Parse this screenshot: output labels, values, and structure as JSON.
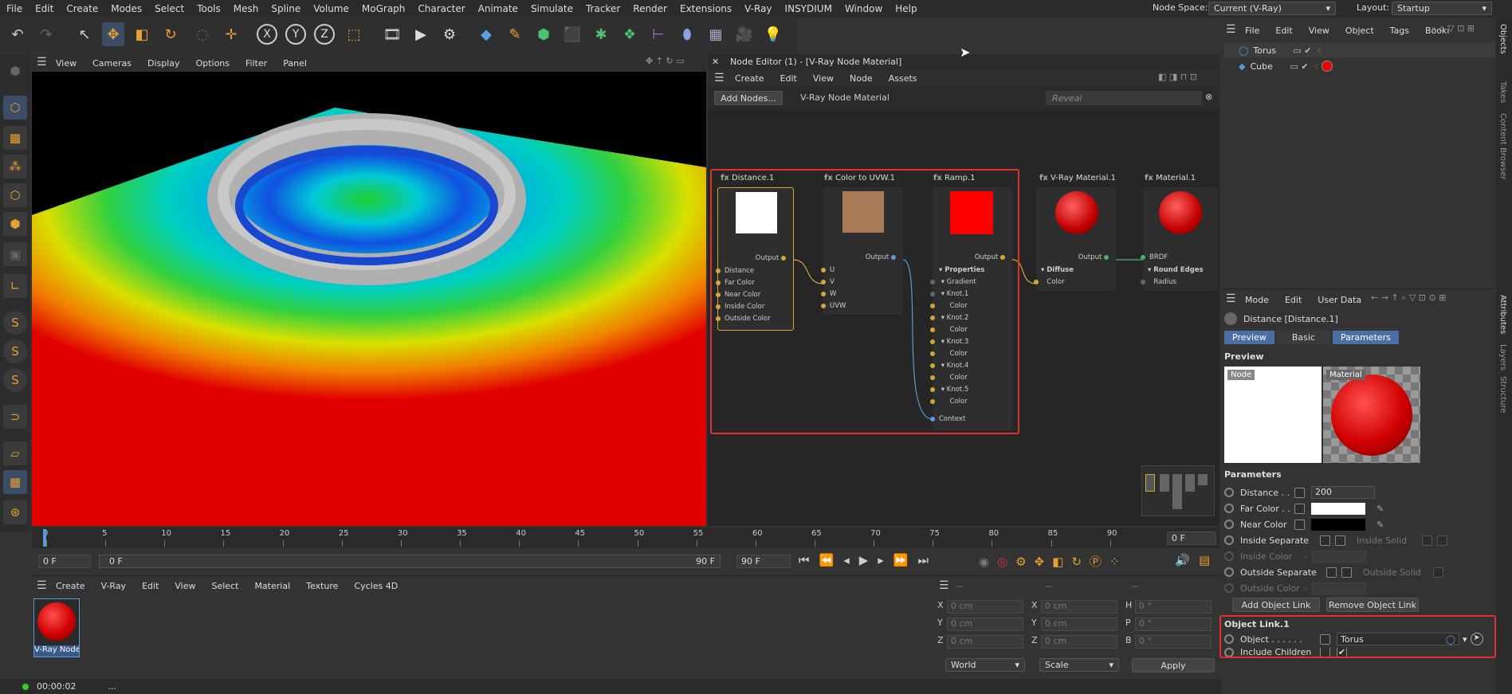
{
  "menu": {
    "items": [
      "File",
      "Edit",
      "Create",
      "Modes",
      "Select",
      "Tools",
      "Mesh",
      "Spline",
      "Volume",
      "MoGraph",
      "Character",
      "Animate",
      "Simulate",
      "Tracker",
      "Render",
      "Extensions",
      "V-Ray",
      "INSYDIUM",
      "Window",
      "Help"
    ]
  },
  "header": {
    "node_space_label": "Node Space:",
    "node_space_value": "Current (V-Ray)",
    "layout_label": "Layout:",
    "layout_value": "Startup"
  },
  "viewport": {
    "menu": [
      "View",
      "Cameras",
      "Display",
      "Options",
      "Filter",
      "Panel"
    ]
  },
  "node_editor": {
    "title": "Node Editor (1) - [V-Ray Node Material]",
    "menu": [
      "Create",
      "Edit",
      "View",
      "Node",
      "Assets"
    ],
    "add_nodes": "Add Nodes...",
    "material_name": "V-Ray Node Material",
    "reveal_placeholder": "Reveal",
    "output_label": "Output",
    "nodes": {
      "distance": {
        "title": "Distance.1",
        "ports": [
          "Distance",
          "Far Color",
          "Near Color",
          "Inside Color",
          "Outside Color"
        ]
      },
      "color_uvw": {
        "title": "Color to UVW.1",
        "ports": [
          "U",
          "V",
          "W",
          "UVW"
        ]
      },
      "ramp": {
        "title": "Ramp.1",
        "ports": [
          "Properties",
          "Gradient",
          "Knot.1",
          "Color",
          "Knot.2",
          "Color",
          "Knot.3",
          "Color",
          "Knot.4",
          "Color",
          "Knot.5",
          "Color",
          "Context"
        ]
      },
      "vray_mat": {
        "title": "V-Ray Material.1",
        "ports": [
          "Diffuse",
          "Color"
        ]
      },
      "material": {
        "title": "Material.1",
        "ports": [
          "BRDF",
          "Round Edges",
          "Radius"
        ]
      }
    }
  },
  "objects": {
    "menu": [
      "File",
      "Edit",
      "View",
      "Object",
      "Tags",
      "Bookı"
    ],
    "items": [
      {
        "name": "Torus"
      },
      {
        "name": "Cube"
      }
    ],
    "side_tabs": [
      "Objects",
      "Takes",
      "Content Browser"
    ]
  },
  "attributes": {
    "menu": [
      "Mode",
      "Edit",
      "User Data"
    ],
    "title": "Distance [Distance.1]",
    "tabs": [
      "Preview",
      "Basic",
      "Parameters"
    ],
    "preview_heading": "Preview",
    "preview_node_label": "Node",
    "preview_material_label": "Material",
    "parameters_heading": "Parameters",
    "distance_label": "Distance . .",
    "distance_value": "200",
    "far_color_label": "Far Color . .",
    "near_color_label": "Near Color",
    "inside_separate_label": "Inside Separate",
    "inside_solid_label": "Inside Solid",
    "inside_color_label": "Inside Color",
    "outside_separate_label": "Outside Separate",
    "outside_solid_label": "Outside Solid",
    "outside_color_label": "Outside Color",
    "add_object_link": "Add Object Link",
    "remove_object_link": "Remove Object Link",
    "object_link_heading": "Object Link.1",
    "object_label": "Object . . . . . .",
    "object_value": "Torus",
    "include_children_label": "Include Children",
    "side_tabs": [
      "Attributes",
      "Layers",
      "Structure"
    ]
  },
  "timeline": {
    "ticks": [
      "0",
      "5",
      "10",
      "15",
      "20",
      "25",
      "30",
      "35",
      "40",
      "45",
      "50",
      "55",
      "60",
      "65",
      "70",
      "75",
      "80",
      "85",
      "90"
    ],
    "current_frame": "0 F",
    "start_frame": "0 F",
    "range_start": "0 F",
    "range_end": "90 F",
    "end_frame": "90 F"
  },
  "material_manager": {
    "menu": [
      "Create",
      "V-Ray",
      "Edit",
      "View",
      "Select",
      "Material",
      "Texture",
      "Cycles 4D"
    ],
    "material_name": "V-Ray Node"
  },
  "coordinates": {
    "rows": [
      [
        "X",
        "0 cm",
        "X",
        "0 cm",
        "H",
        "0 °"
      ],
      [
        "Y",
        "0 cm",
        "Y",
        "0 cm",
        "P",
        "0 °"
      ],
      [
        "Z",
        "0 cm",
        "Z",
        "0 cm",
        "B",
        "0 °"
      ]
    ],
    "mode_world": "World",
    "mode_scale": "Scale",
    "apply": "Apply",
    "dashes": [
      "--",
      "--",
      "--"
    ]
  },
  "status": {
    "time": "00:00:02",
    "text": "..."
  },
  "colors": {
    "accent": "#4a6fa5",
    "highlight": "#e03030",
    "node_orange": "#d4a838"
  }
}
